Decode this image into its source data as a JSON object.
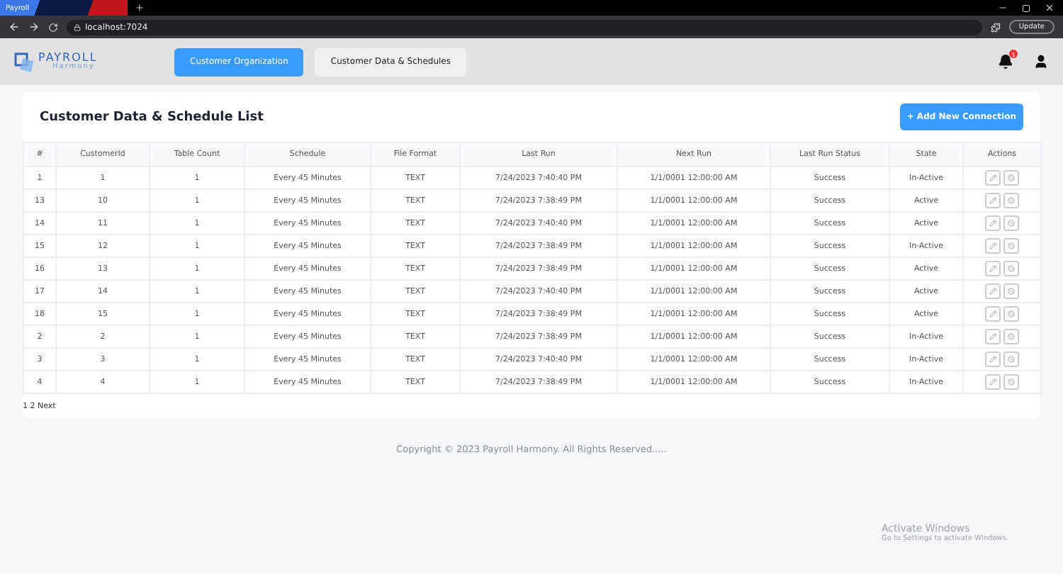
{
  "browser": {
    "tab_title": "Payroll",
    "url": "localhost:7024",
    "update_label": "Update"
  },
  "header": {
    "logo_top": "PAYROLL",
    "logo_bottom": "Harmony",
    "nav": [
      {
        "label": "Customer Organization",
        "selected": true
      },
      {
        "label": "Customer Data & Schedules",
        "selected": false
      }
    ],
    "notification_count": "1"
  },
  "card": {
    "title": "Customer Data & Schedule List",
    "add_button": "+ Add New Connection"
  },
  "table": {
    "columns": [
      "#",
      "CustomerId",
      "Table Count",
      "Schedule",
      "File Format",
      "Last Run",
      "Next Run",
      "Last Run Status",
      "State",
      "Actions"
    ],
    "rows": [
      [
        "1",
        "1",
        "1",
        "Every 45 Minutes",
        "TEXT",
        "7/24/2023 7:40:40 PM",
        "1/1/0001 12:00:00 AM",
        "Success",
        "In-Active"
      ],
      [
        "13",
        "10",
        "1",
        "Every 45 Minutes",
        "TEXT",
        "7/24/2023 7:38:49 PM",
        "1/1/0001 12:00:00 AM",
        "Success",
        "Active"
      ],
      [
        "14",
        "11",
        "1",
        "Every 45 Minutes",
        "TEXT",
        "7/24/2023 7:40:40 PM",
        "1/1/0001 12:00:00 AM",
        "Success",
        "Active"
      ],
      [
        "15",
        "12",
        "1",
        "Every 45 Minutes",
        "TEXT",
        "7/24/2023 7:38:49 PM",
        "1/1/0001 12:00:00 AM",
        "Success",
        "In-Active"
      ],
      [
        "16",
        "13",
        "1",
        "Every 45 Minutes",
        "TEXT",
        "7/24/2023 7:38:49 PM",
        "1/1/0001 12:00:00 AM",
        "Success",
        "Active"
      ],
      [
        "17",
        "14",
        "1",
        "Every 45 Minutes",
        "TEXT",
        "7/24/2023 7:40:40 PM",
        "1/1/0001 12:00:00 AM",
        "Success",
        "Active"
      ],
      [
        "18",
        "15",
        "1",
        "Every 45 Minutes",
        "TEXT",
        "7/24/2023 7:38:49 PM",
        "1/1/0001 12:00:00 AM",
        "Success",
        "Active"
      ],
      [
        "2",
        "2",
        "1",
        "Every 45 Minutes",
        "TEXT",
        "7/24/2023 7:38:49 PM",
        "1/1/0001 12:00:00 AM",
        "Success",
        "In-Active"
      ],
      [
        "3",
        "3",
        "1",
        "Every 45 Minutes",
        "TEXT",
        "7/24/2023 7:40:40 PM",
        "1/1/0001 12:00:00 AM",
        "Success",
        "In-Active"
      ],
      [
        "4",
        "4",
        "1",
        "Every 45 Minutes",
        "TEXT",
        "7/24/2023 7:38:49 PM",
        "1/1/0001 12:00:00 AM",
        "Success",
        "In-Active"
      ]
    ]
  },
  "pagination": "1 2 Next",
  "footer": "Copyright © 2023 Payroll Harmony. All Rights Reserved.....",
  "os_notice": {
    "title": "Activate Windows",
    "subtitle": "Go to Settings to activate Windows."
  }
}
